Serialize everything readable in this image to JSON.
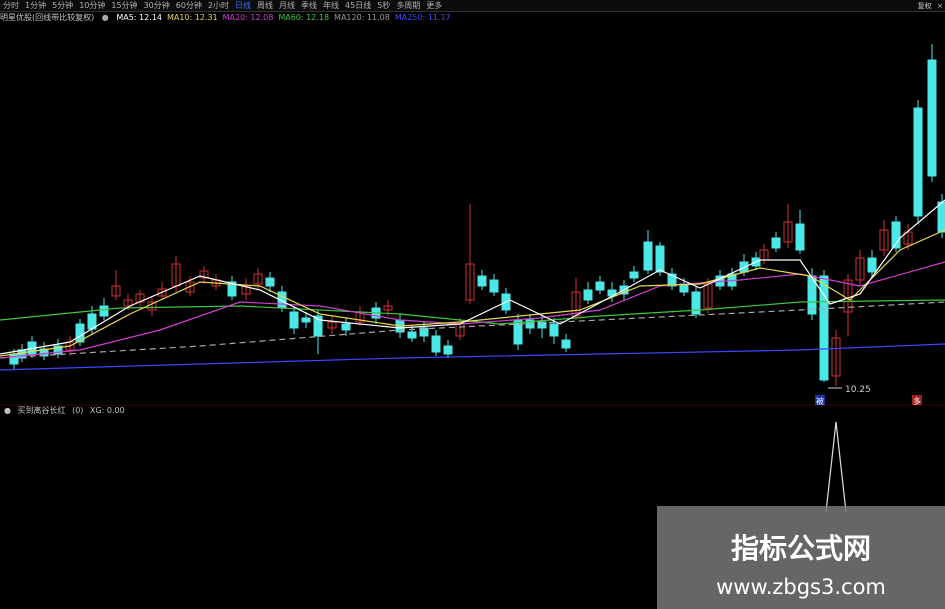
{
  "period_tabs": [
    "分时",
    "1分钟",
    "5分钟",
    "10分钟",
    "15分钟",
    "30分钟",
    "60分钟",
    "2小时",
    "日线",
    "周线",
    "月线",
    "季线",
    "年线",
    "45日线",
    "5秒",
    "多周期",
    "更多"
  ],
  "active_tab_index": 8,
  "right_buttons": [
    "复权",
    "×"
  ],
  "main_indicator": {
    "name": "明星优股(回线带比较复权)",
    "ma": [
      {
        "label": "MA5: 12.14",
        "color": "#ffffff"
      },
      {
        "label": "MA10: 12.31",
        "color": "#e8d84a"
      },
      {
        "label": "MA20: 12.08",
        "color": "#d040d0"
      },
      {
        "label": "MA60: 12.18",
        "color": "#3cc83c"
      },
      {
        "label": "MA120: 11.08",
        "color": "#9a9a9a"
      },
      {
        "label": "MA250: 11.17",
        "color": "#3c48ff"
      }
    ]
  },
  "price_marks": {
    "low_label": "10.25",
    "flag_left": "被",
    "flag_right": "多"
  },
  "sub_indicator": {
    "name": "买到离谷长红",
    "params": "(0)",
    "value": "XG: 0.00"
  },
  "watermark": {
    "title": "指标公式网",
    "url": "www.zbgs3.com"
  },
  "colors": {
    "up": "#d03030",
    "down": "#4ce8e8",
    "background": "#000000"
  }
}
